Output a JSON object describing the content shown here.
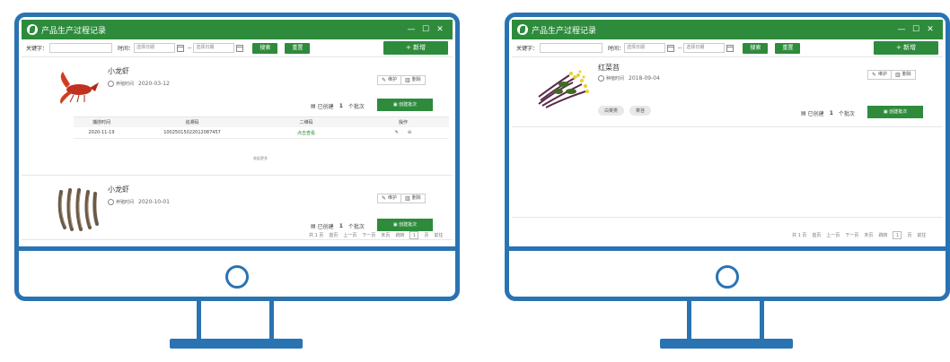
{
  "window": {
    "title": "产品生产过程记录",
    "minimize": "—",
    "maximize": "☐",
    "close": "✕"
  },
  "toolbar": {
    "keyword_label": "关键字：",
    "time_label": "时间：",
    "date_placeholder": "选择日期",
    "range_sep": "--",
    "search_label": "搜索",
    "reset_label": "重置",
    "add_label": "+ 新增"
  },
  "screen1": {
    "products": [
      {
        "name": "小龙虾",
        "date_label": "养殖时间",
        "date": "2020-03-12",
        "maintain": "维护",
        "delete": "删除",
        "created_label": "已创建",
        "batch_count": "1",
        "batch_unit": "个批次",
        "create_batch": "创建批次"
      },
      {
        "name": "小龙虾",
        "date_label": "养殖时间",
        "date": "2020-10-01",
        "maintain": "维护",
        "delete": "删除",
        "created_label": "已创建",
        "batch_count": "1",
        "batch_unit": "个批次",
        "create_batch": "创建批次"
      }
    ],
    "batch_table": {
      "headers": [
        "捕捞时间",
        "追溯码",
        "二维码",
        "操作"
      ],
      "rows": [
        {
          "time": "2020-11-19",
          "code": "10025015022012087457",
          "qr": "点击查看"
        }
      ],
      "collapse": "收起更多"
    },
    "pager": {
      "total": "共 1 页",
      "first": "首页",
      "prev": "上一页",
      "next": "下一页",
      "last": "末页",
      "goto": "跳转",
      "page": "1",
      "page_unit": "页",
      "go": "前往"
    }
  },
  "screen2": {
    "products": [
      {
        "name": "红菜苔",
        "date_label": "种植时间",
        "date": "2018-09-04",
        "tags": [
          "白菜类",
          "菜苔"
        ],
        "maintain": "维护",
        "delete": "删除",
        "created_label": "已创建",
        "batch_count": "1",
        "batch_unit": "个批次",
        "create_batch": "创建批次"
      }
    ],
    "pager": {
      "total": "共 1 页",
      "first": "首页",
      "prev": "上一页",
      "next": "下一页",
      "last": "末页",
      "goto": "跳转",
      "page": "1",
      "page_unit": "页",
      "go": "前往"
    }
  },
  "icons": {
    "logo": "leaf-logo-icon",
    "clock": "clock-icon",
    "edit": "pencil-icon",
    "trash": "trash-icon",
    "list": "list-icon",
    "doc": "document-icon"
  },
  "colors": {
    "frame": "#2a73b3",
    "primary": "#2e8b3c"
  }
}
